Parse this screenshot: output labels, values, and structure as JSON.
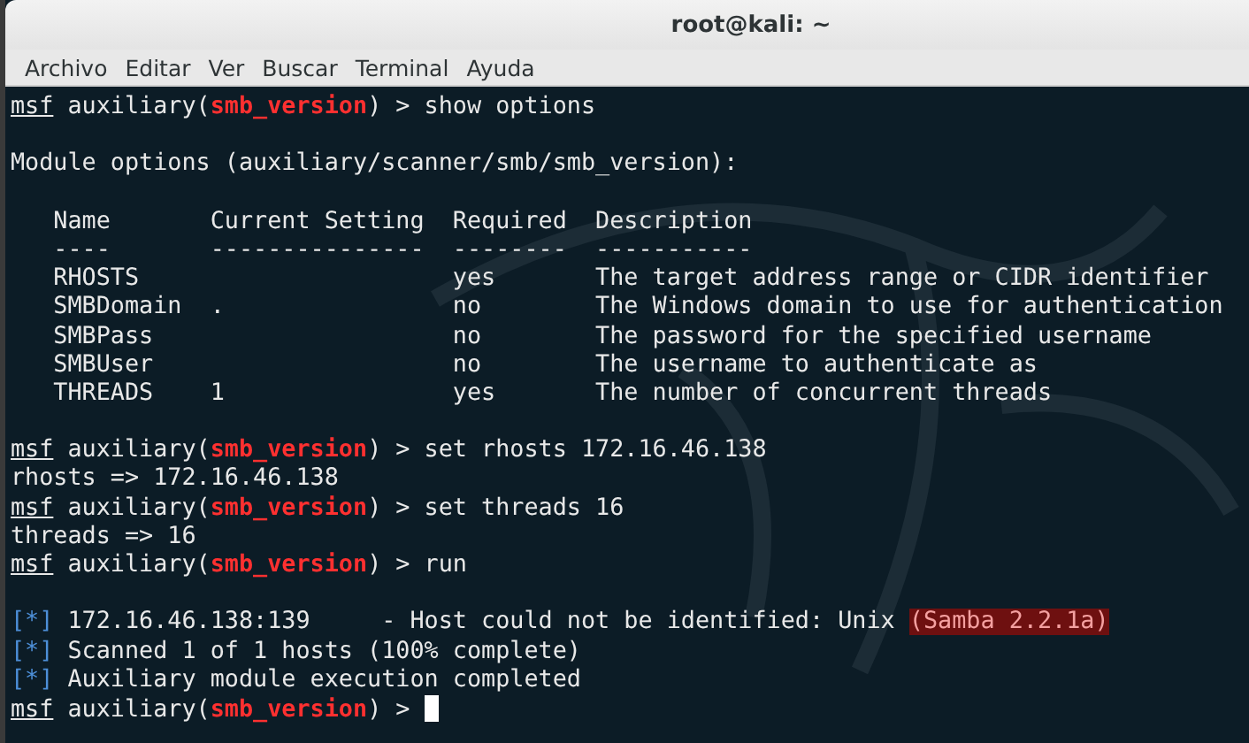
{
  "window": {
    "title": "root@kali: ~"
  },
  "menu": [
    "Archivo",
    "Editar",
    "Ver",
    "Buscar",
    "Terminal",
    "Ayuda"
  ],
  "lines": [
    {
      "kind": "prompt",
      "user": "msf",
      "before": "auxiliary(",
      "module": "smb_version",
      "after": ") > show options"
    },
    {
      "kind": "blank"
    },
    {
      "kind": "text",
      "text": "Module options (auxiliary/scanner/smb/smb_version):"
    },
    {
      "kind": "blank"
    },
    {
      "kind": "text",
      "text": "   Name       Current Setting  Required  Description"
    },
    {
      "kind": "text",
      "text": "   ----       ---------------  --------  -----------"
    },
    {
      "kind": "text",
      "text": "   RHOSTS                      yes       The target address range or CIDR identifier"
    },
    {
      "kind": "text",
      "text": "   SMBDomain  .                no        The Windows domain to use for authentication"
    },
    {
      "kind": "text",
      "text": "   SMBPass                     no        The password for the specified username"
    },
    {
      "kind": "text",
      "text": "   SMBUser                     no        The username to authenticate as"
    },
    {
      "kind": "text",
      "text": "   THREADS    1                yes       The number of concurrent threads"
    },
    {
      "kind": "blank"
    },
    {
      "kind": "prompt",
      "user": "msf",
      "before": "auxiliary(",
      "module": "smb_version",
      "after": ") > set rhosts 172.16.46.138"
    },
    {
      "kind": "text",
      "text": "rhosts => 172.16.46.138"
    },
    {
      "kind": "prompt",
      "user": "msf",
      "before": "auxiliary(",
      "module": "smb_version",
      "after": ") > set threads 16"
    },
    {
      "kind": "text",
      "text": "threads => 16"
    },
    {
      "kind": "prompt",
      "user": "msf",
      "before": "auxiliary(",
      "module": "smb_version",
      "after": ") > run"
    },
    {
      "kind": "blank"
    },
    {
      "kind": "info",
      "tag": "[*]",
      "text": "172.16.46.138:139     - Host could not be identified: Unix ",
      "highlight": "(Samba 2.2.1a)"
    },
    {
      "kind": "info",
      "tag": "[*]",
      "text": "Scanned 1 of 1 hosts (100% complete)"
    },
    {
      "kind": "info",
      "tag": "[*]",
      "text": "Auxiliary module execution completed"
    },
    {
      "kind": "prompt",
      "user": "msf",
      "before": "auxiliary(",
      "module": "smb_version",
      "after": ") > ",
      "cursor": true
    }
  ]
}
